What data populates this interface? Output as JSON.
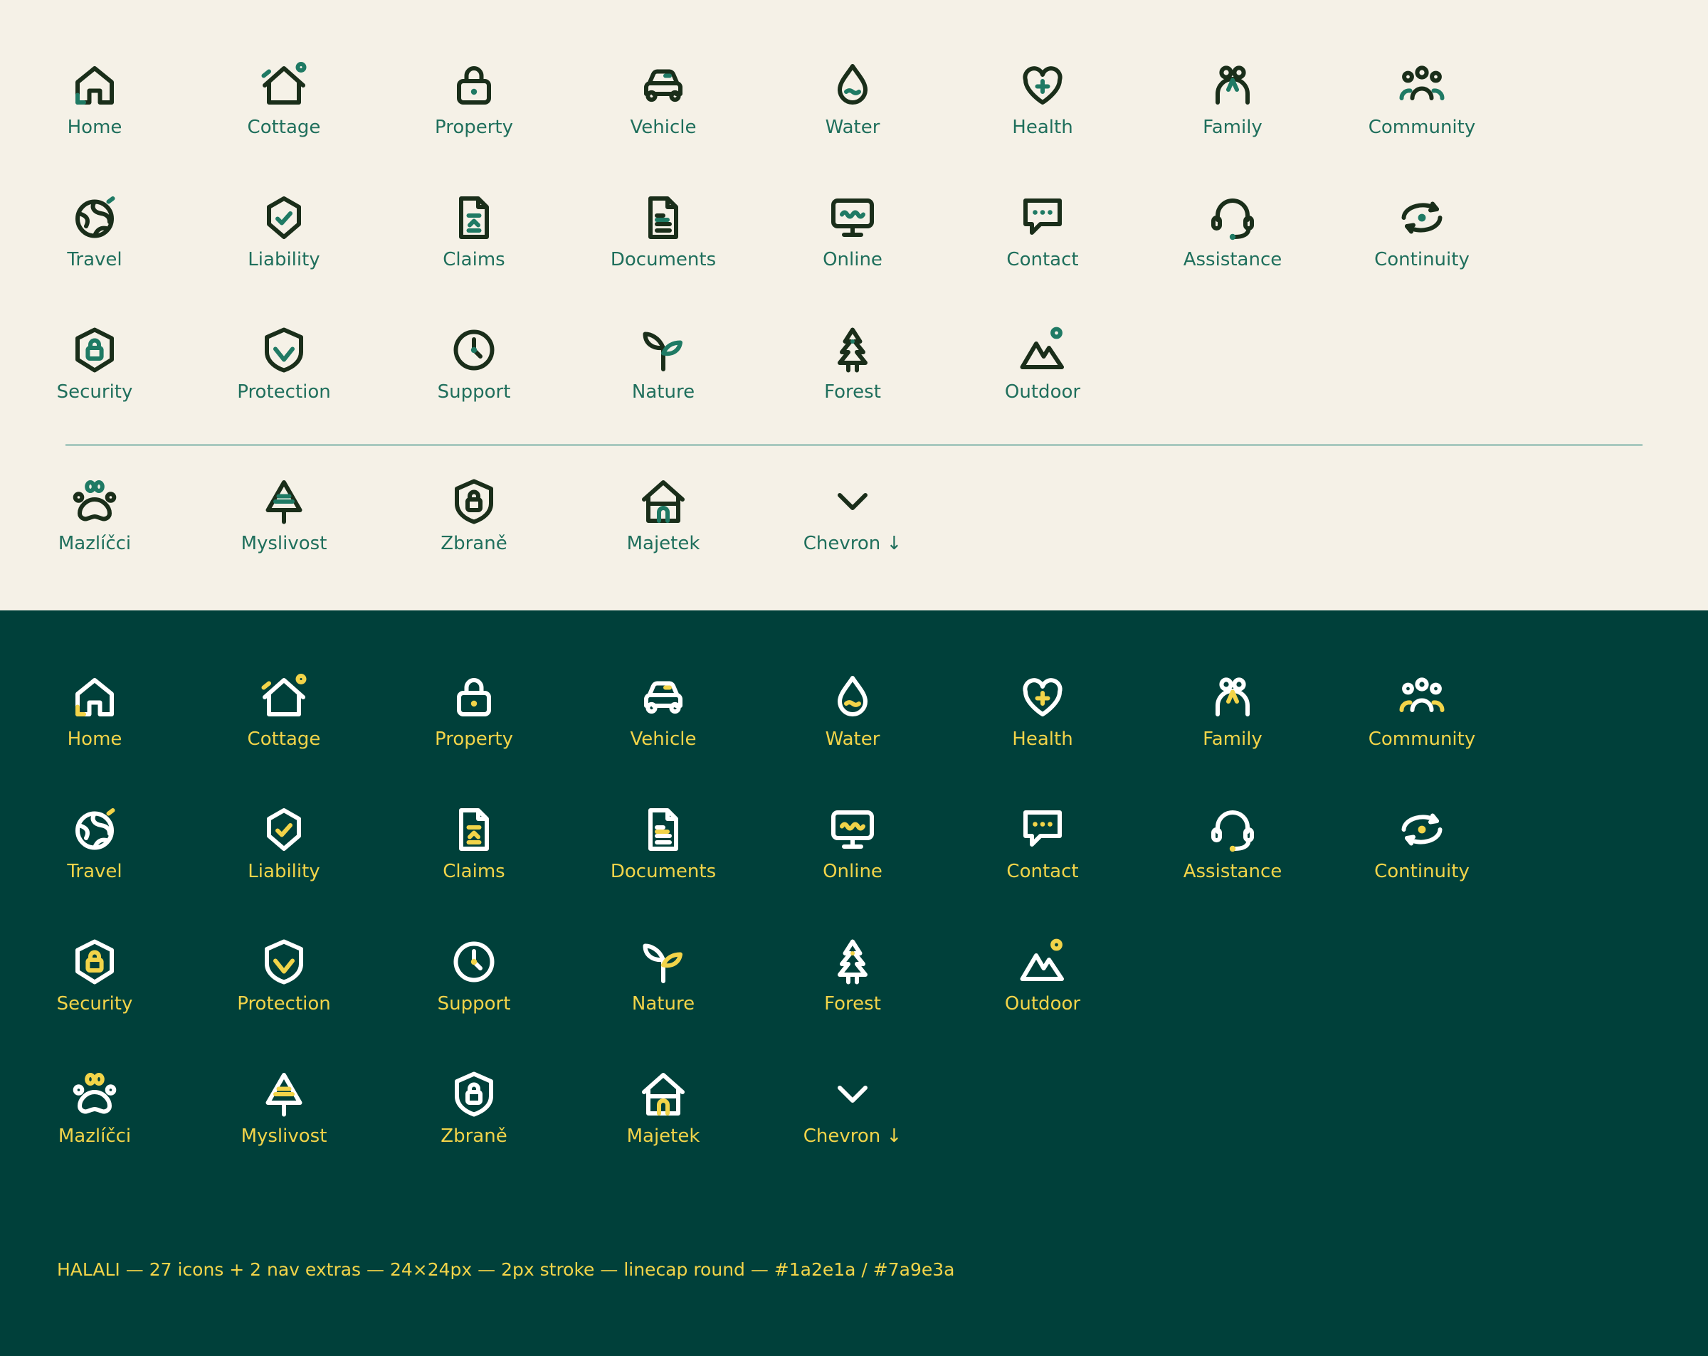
{
  "colors": {
    "light_bg": "#f5f1e7",
    "dark_bg": "#00403a",
    "ink": "#1a2e1a",
    "accent": "#7a9e3a",
    "light_label": "#1f6f5c",
    "dark_label": "#f2d449",
    "divider": "#a9c9bf"
  },
  "rows": [
    [
      {
        "label": "Home",
        "icon": "home-icon"
      },
      {
        "label": "Cottage",
        "icon": "cottage-icon"
      },
      {
        "label": "Property",
        "icon": "property-icon"
      },
      {
        "label": "Vehicle",
        "icon": "vehicle-icon"
      },
      {
        "label": "Water",
        "icon": "water-icon"
      },
      {
        "label": "Health",
        "icon": "health-icon"
      },
      {
        "label": "Family",
        "icon": "family-icon"
      },
      {
        "label": "Community",
        "icon": "community-icon"
      }
    ],
    [
      {
        "label": "Travel",
        "icon": "travel-icon"
      },
      {
        "label": "Liability",
        "icon": "liability-icon"
      },
      {
        "label": "Claims",
        "icon": "claims-icon"
      },
      {
        "label": "Documents",
        "icon": "documents-icon"
      },
      {
        "label": "Online",
        "icon": "online-icon"
      },
      {
        "label": "Contact",
        "icon": "contact-icon"
      },
      {
        "label": "Assistance",
        "icon": "assistance-icon"
      },
      {
        "label": "Continuity",
        "icon": "continuity-icon"
      }
    ],
    [
      {
        "label": "Security",
        "icon": "security-icon"
      },
      {
        "label": "Protection",
        "icon": "protection-icon"
      },
      {
        "label": "Support",
        "icon": "support-icon"
      },
      {
        "label": "Nature",
        "icon": "nature-icon"
      },
      {
        "label": "Forest",
        "icon": "forest-icon"
      },
      {
        "label": "Outdoor",
        "icon": "outdoor-icon"
      }
    ],
    [
      {
        "label": "Mazlíčci",
        "icon": "pets-icon"
      },
      {
        "label": "Myslivost",
        "icon": "hunting-icon"
      },
      {
        "label": "Zbraně",
        "icon": "weapons-icon"
      },
      {
        "label": "Majetek",
        "icon": "estate-icon"
      },
      {
        "label": "Chevron ↓",
        "icon": "chevron-down-icon"
      }
    ]
  ],
  "footer": "HALALI — 27 icons + 2 nav extras — 24×24px — 2px stroke — linecap round — #1a2e1a / #7a9e3a"
}
